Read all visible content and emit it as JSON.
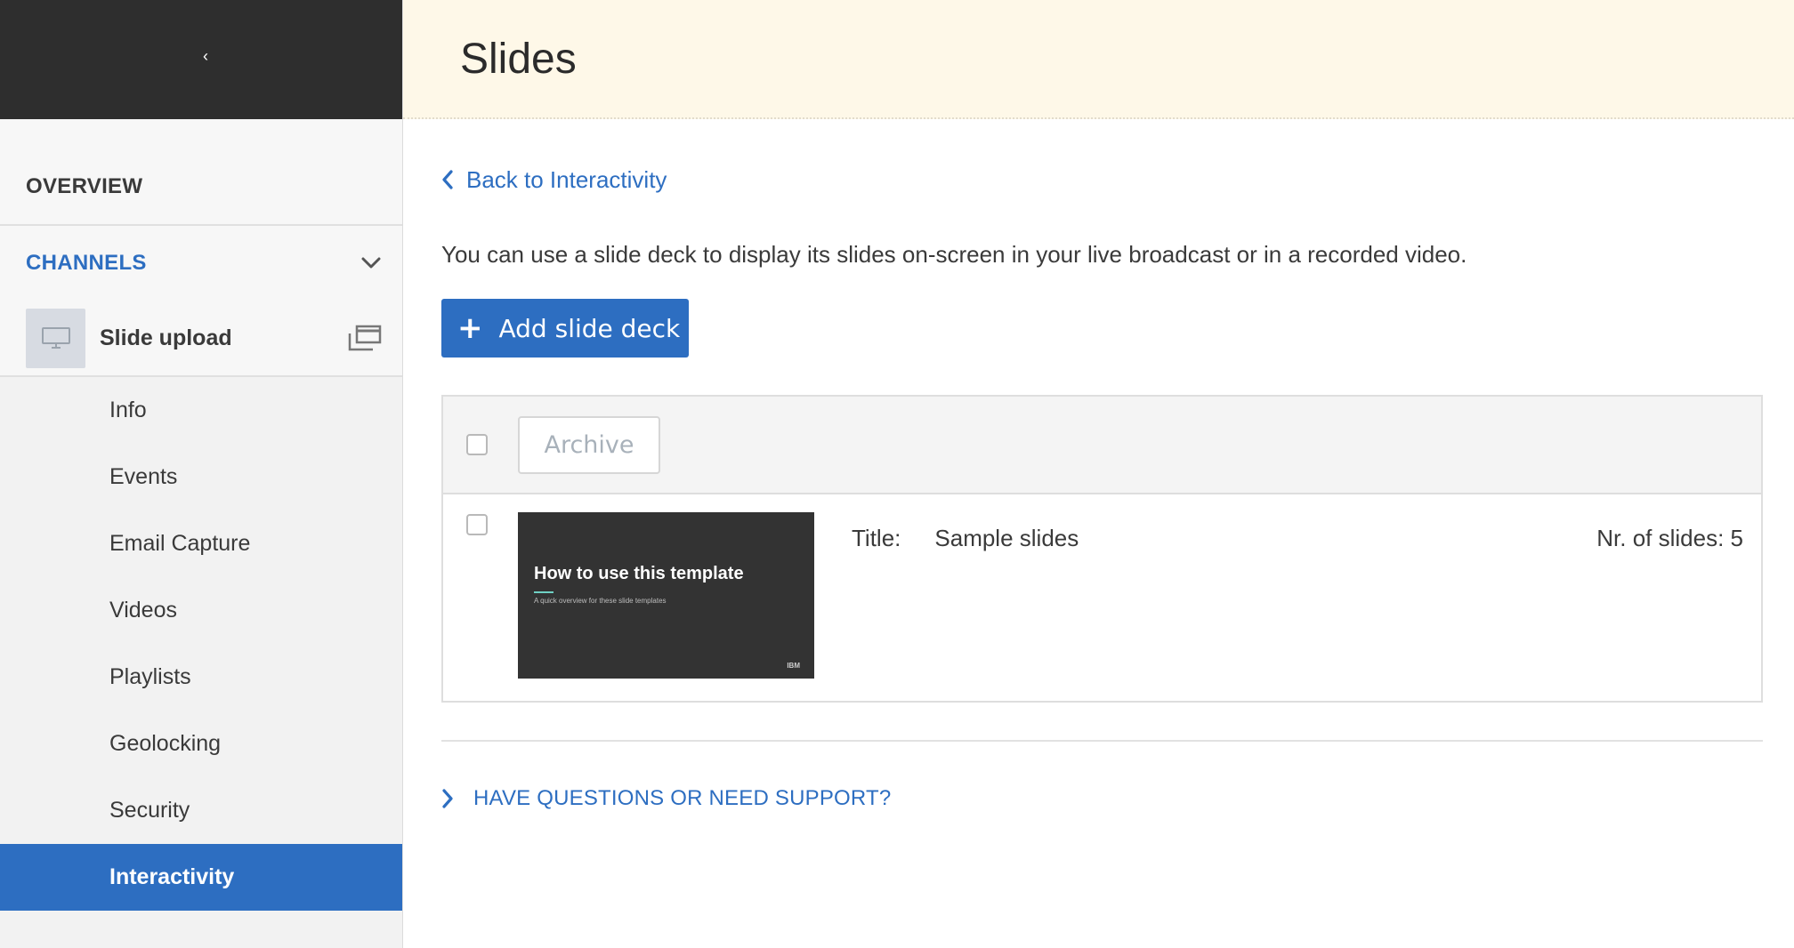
{
  "sidebar": {
    "collapse_glyph": "‹",
    "overview_label": "OVERVIEW",
    "channels_label": "CHANNELS",
    "channel": {
      "name": "Slide upload"
    },
    "items": [
      {
        "label": "Info"
      },
      {
        "label": "Events"
      },
      {
        "label": "Email Capture"
      },
      {
        "label": "Videos"
      },
      {
        "label": "Playlists"
      },
      {
        "label": "Geolocking"
      },
      {
        "label": "Security"
      },
      {
        "label": "Interactivity",
        "active": true
      }
    ]
  },
  "header": {
    "title": "Slides"
  },
  "main": {
    "back_link": "Back to Interactivity",
    "intro": "You can use a slide deck to display its slides on-screen in your live broadcast or in a recorded video.",
    "add_button": "Add slide deck",
    "archive_button": "Archive",
    "decks": [
      {
        "thumb_title": "How to use this template",
        "thumb_subtitle": "A quick overview for these slide templates",
        "thumb_logo": "IBM",
        "title_label": "Title:",
        "title": "Sample slides",
        "slides_count": "Nr. of slides: 5"
      }
    ],
    "support_link": "HAVE QUESTIONS OR NEED SUPPORT?"
  },
  "colors": {
    "accent": "#2d6ec1",
    "sidebar_top": "#2e2e2e",
    "header_bg": "#fef8e8"
  }
}
